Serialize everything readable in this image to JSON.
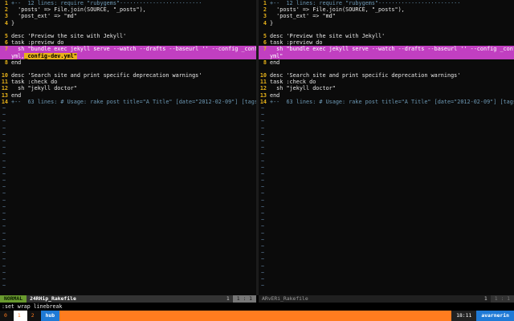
{
  "editor": {
    "left_pane": {
      "lines": [
        {
          "num": "1",
          "text": "+--  12 lines: require \"rubygems\"·························",
          "kind": "fold"
        },
        {
          "num": "2",
          "text": "  'posts' => File.join(SOURCE, \"_posts\"),",
          "kind": "code"
        },
        {
          "num": "3",
          "text": "  'post_ext' => \"md\"",
          "kind": "code"
        },
        {
          "num": "4",
          "text": "}",
          "kind": "code"
        },
        {
          "num": "",
          "text": "",
          "kind": "code"
        },
        {
          "num": "5",
          "text": "desc 'Preview the site with Jekyll'",
          "kind": "code"
        },
        {
          "num": "6",
          "text": "task :preview do",
          "kind": "code"
        },
        {
          "num": "7",
          "text": "  sh \"bundle exec jekyll serve --watch --drafts --baseurl '' --config _config.",
          "kind": "highlight"
        },
        {
          "num": "",
          "text": "yml,",
          "sel": "_config-dev.yml\"",
          "kind": "highlight-cont"
        },
        {
          "num": "8",
          "text": "end",
          "kind": "code"
        },
        {
          "num": "",
          "text": "",
          "kind": "code"
        },
        {
          "num": "10",
          "text": "desc 'Search site and print specific deprecation warnings'",
          "kind": "code"
        },
        {
          "num": "11",
          "text": "task :check do",
          "kind": "code"
        },
        {
          "num": "12",
          "text": "  sh \"jekyll doctor\"",
          "kind": "code"
        },
        {
          "num": "13",
          "text": "end",
          "kind": "code"
        },
        {
          "num": "14",
          "text": "+--  63 lines: # Usage: rake post title=\"A Title\" [date=\"2012-02-09\"] [tags=[tag1,ta",
          "kind": "fold"
        }
      ]
    },
    "right_pane": {
      "lines": [
        {
          "num": "1",
          "text": "+--  12 lines: require \"rubygems\"·························",
          "kind": "fold"
        },
        {
          "num": "2",
          "text": "  'posts' => File.join(SOURCE, \"_posts\"),",
          "kind": "code"
        },
        {
          "num": "3",
          "text": "  'post_ext' => \"md\"",
          "kind": "code"
        },
        {
          "num": "4",
          "text": "}",
          "kind": "code"
        },
        {
          "num": "",
          "text": "",
          "kind": "code"
        },
        {
          "num": "5",
          "text": "desc 'Preview the site with Jekyll'",
          "kind": "code"
        },
        {
          "num": "6",
          "text": "task :preview do",
          "kind": "code"
        },
        {
          "num": "7",
          "text": "  sh \"bundle exec jekyll serve --watch --drafts --baseurl '' --config _config.",
          "kind": "highlight"
        },
        {
          "num": "",
          "text": "yml\"",
          "kind": "highlight-cont"
        },
        {
          "num": "8",
          "text": "end",
          "kind": "code"
        },
        {
          "num": "",
          "text": "",
          "kind": "code"
        },
        {
          "num": "10",
          "text": "desc 'Search site and print specific deprecation warnings'",
          "kind": "code"
        },
        {
          "num": "11",
          "text": "task :check do",
          "kind": "code"
        },
        {
          "num": "12",
          "text": "  sh \"jekyll doctor\"",
          "kind": "code"
        },
        {
          "num": "13",
          "text": "end",
          "kind": "code"
        },
        {
          "num": "14",
          "text": "+--  63 lines: # Usage: rake post title=\"A Title\" [date=\"2012-02-09\"] [tags=[tag1,ta",
          "kind": "fold"
        }
      ]
    },
    "tilde": "~"
  },
  "status_left": {
    "mode": "NORMAL",
    "filename": "24RHip_Rakefile",
    "percent": "1",
    "position": "1 :  1"
  },
  "status_right": {
    "filename": "ARvERi_Rakefile",
    "percent": "1",
    "position": "1 :  1"
  },
  "cmdline": ":set wrap linebreak",
  "tmux": {
    "windows": [
      {
        "num": "0",
        "name": "",
        "active": false
      },
      {
        "num": "1",
        "name": "",
        "active": true
      },
      {
        "num": "2",
        "name": "",
        "active": false
      }
    ],
    "session": "hub",
    "clock": "18:11",
    "user": "avarnerin"
  },
  "colors": {
    "highlight": "#c13fc1",
    "line_number": "#e8b21a",
    "mode_normal": "#6a9b2f",
    "tmux_bar": "#ff7c1f",
    "tmux_accent": "#1f7ad6"
  }
}
